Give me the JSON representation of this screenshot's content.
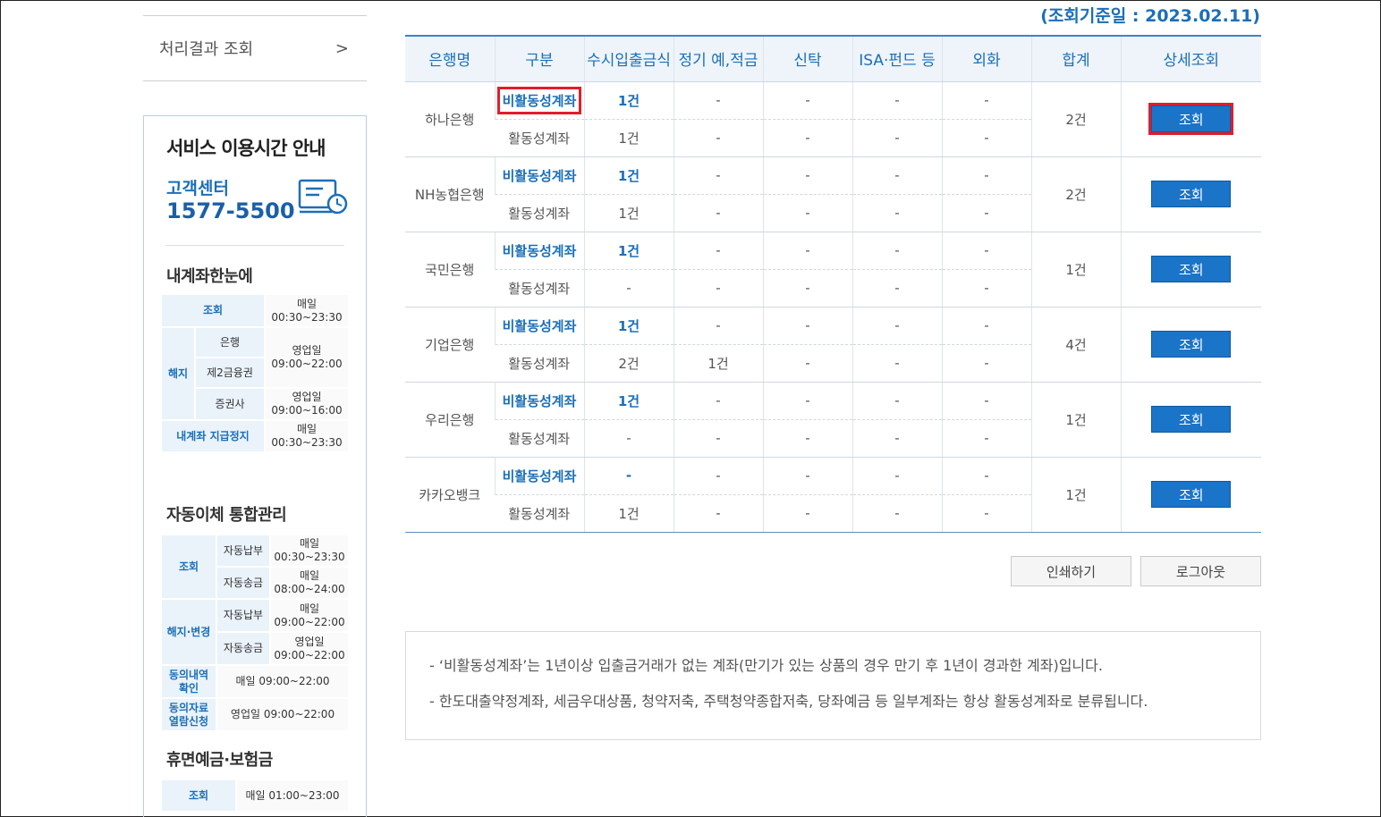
{
  "sidebar": {
    "menu_label": "처리결과 조회",
    "menu_arrow": ">",
    "info_title": "서비스 이용시간 안내",
    "customer_center_label": "고객센터",
    "customer_center_phone": "1577-5500",
    "sections": [
      {
        "title": "내계좌한눈에",
        "rows": {
          "view": {
            "cat": "조회",
            "time": "매일\n00:30~23:30"
          },
          "close_cat": "해지",
          "bank": "은행",
          "second_fin": "제2금융권",
          "bank_time": "영업일\n09:00~22:00",
          "securities": "증권사",
          "securities_time": "영업일\n09:00~16:00",
          "stop": {
            "cat": "내계좌 지급정지",
            "time": "매일\n00:30~23:30"
          }
        }
      },
      {
        "title": "자동이체 통합관리",
        "rows": {
          "view_cat": "조회",
          "auto_pay": "자동납부",
          "auto_pay_time": "매일\n00:30~23:30",
          "auto_send": "자동송금",
          "auto_send_time": "매일\n08:00~24:00",
          "change_cat": "해지·변경",
          "auto_pay2": "자동납부",
          "auto_pay2_time": "매일\n09:00~22:00",
          "auto_send2": "자동송금",
          "auto_send2_time": "영업일\n09:00~22:00",
          "consent": "동의내역\n확인",
          "consent_time": "매일 09:00~22:00",
          "data_req": "동의자료\n열람신청",
          "data_req_time": "영업일 09:00~22:00"
        }
      },
      {
        "title": "휴면예금·보험금",
        "rows": {
          "view": {
            "cat": "조회",
            "time": "매일 01:00~23:00"
          }
        }
      }
    ]
  },
  "main": {
    "ref_date": "(조회기준일 : 2023.02.11)",
    "headers": [
      "은행명",
      "구분",
      "수시입출금식",
      "정기 예,적금",
      "신탁",
      "ISA·펀드 등",
      "외화",
      "합계",
      "상세조회"
    ],
    "banks": [
      {
        "name": "하나은행",
        "total": "2건",
        "btn": "조회",
        "inactive": {
          "label": "비활동성계좌",
          "vals": [
            "1건",
            "-",
            "-",
            "-",
            "-"
          ]
        },
        "active": {
          "label": "활동성계좌",
          "vals": [
            "1건",
            "-",
            "-",
            "-",
            "-"
          ]
        }
      },
      {
        "name": "NH농협은행",
        "total": "2건",
        "btn": "조회",
        "inactive": {
          "label": "비활동성계좌",
          "vals": [
            "1건",
            "-",
            "-",
            "-",
            "-"
          ]
        },
        "active": {
          "label": "활동성계좌",
          "vals": [
            "1건",
            "-",
            "-",
            "-",
            "-"
          ]
        }
      },
      {
        "name": "국민은행",
        "total": "1건",
        "btn": "조회",
        "inactive": {
          "label": "비활동성계좌",
          "vals": [
            "1건",
            "-",
            "-",
            "-",
            "-"
          ]
        },
        "active": {
          "label": "활동성계좌",
          "vals": [
            "-",
            "-",
            "-",
            "-",
            "-"
          ]
        }
      },
      {
        "name": "기업은행",
        "total": "4건",
        "btn": "조회",
        "inactive": {
          "label": "비활동성계좌",
          "vals": [
            "1건",
            "-",
            "-",
            "-",
            "-"
          ]
        },
        "active": {
          "label": "활동성계좌",
          "vals": [
            "2건",
            "1건",
            "-",
            "-",
            "-"
          ]
        }
      },
      {
        "name": "우리은행",
        "total": "1건",
        "btn": "조회",
        "inactive": {
          "label": "비활동성계좌",
          "vals": [
            "1건",
            "-",
            "-",
            "-",
            "-"
          ]
        },
        "active": {
          "label": "활동성계좌",
          "vals": [
            "-",
            "-",
            "-",
            "-",
            "-"
          ]
        }
      },
      {
        "name": "카카오뱅크",
        "total": "1건",
        "btn": "조회",
        "inactive": {
          "label": "비활동성계좌",
          "vals": [
            "-",
            "-",
            "-",
            "-",
            "-"
          ]
        },
        "active": {
          "label": "활동성계좌",
          "vals": [
            "1건",
            "-",
            "-",
            "-",
            "-"
          ]
        }
      }
    ],
    "print_label": "인쇄하기",
    "logout_label": "로그아웃",
    "notes": [
      "- ‘비활동성계좌’는 1년이상 입출금거래가 없는 계좌(만기가 있는 상품의 경우 만기 후 1년이 경과한 계좌)입니다.",
      "- 한도대출약정계좌, 세금우대상품, 청약저축, 주택청약종합저축, 당좌예금 등 일부계좌는 항상 활동성계좌로 분류됩니다."
    ]
  },
  "colors": {
    "accent": "#1b6fb8",
    "button": "#1a74c8",
    "highlight": "#e11d2c"
  }
}
